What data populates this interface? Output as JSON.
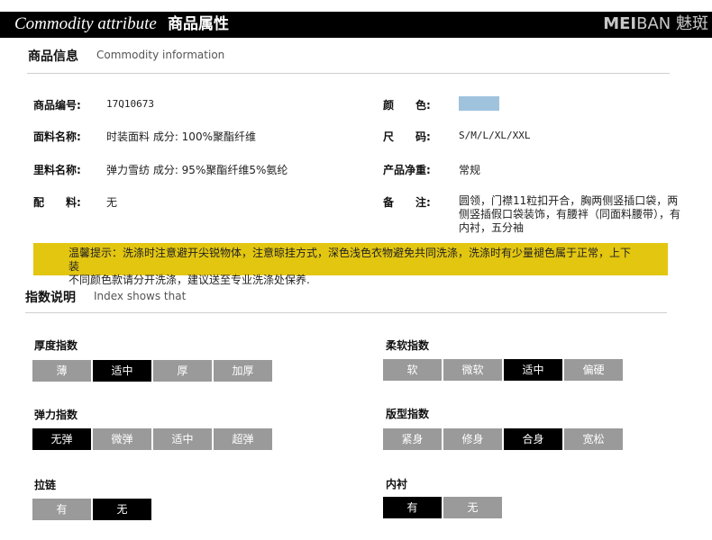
{
  "header": {
    "title_en": "Commodity attribute",
    "title_cn": "商品属性",
    "brand_bold": "MEI",
    "brand_light": "BAN",
    "brand_cn": "魅斑"
  },
  "info": {
    "title": "商品信息",
    "subtitle": "Commodity information",
    "left": [
      {
        "label": "商品编号:",
        "value": "17Q10673"
      },
      {
        "label": "面料名称:",
        "value": "时装面料 成分: 100%聚酯纤维"
      },
      {
        "label": "里料名称:",
        "value": "弹力雪纺 成分: 95%聚酯纤维5%氨纶"
      },
      {
        "label": "配　　料:",
        "value": "无"
      }
    ],
    "right": [
      {
        "label": "颜　　色:",
        "value": "",
        "swatch_color": "#9fc3dd"
      },
      {
        "label": "尺　　码:",
        "value": "S/M/L/XL/XXL"
      },
      {
        "label": "产品净重:",
        "value": "常规"
      },
      {
        "label": "备　　注:",
        "value": "圆领，门襟11粒扣开合，胸两侧竖插口袋，两侧竖插假口袋装饰，有腰袢（同面料腰带），有内衬，五分袖"
      }
    ],
    "notice_line1": "温馨提示：洗涤时注意避开尖锐物体，注意晾挂方式，深色浅色衣物避免共同洗涤，洗涤时有少量褪色属于正常，上下装",
    "notice_line2": "不同颜色款请分开洗涤，建议送至专业洗涤处保养."
  },
  "index": {
    "title": "指数说明",
    "subtitle": "Index shows that",
    "groups": [
      {
        "title": "厚度指数",
        "options": [
          "薄",
          "适中",
          "厚",
          "加厚"
        ],
        "selected": 1
      },
      {
        "title": "柔软指数",
        "options": [
          "软",
          "微软",
          "适中",
          "偏硬"
        ],
        "selected": 2
      },
      {
        "title": "弹力指数",
        "options": [
          "无弹",
          "微弹",
          "适中",
          "超弹"
        ],
        "selected": 0
      },
      {
        "title": "版型指数",
        "options": [
          "紧身",
          "修身",
          "合身",
          "宽松"
        ],
        "selected": 2
      },
      {
        "title": "拉链",
        "options": [
          "有",
          "无"
        ],
        "selected": 1
      },
      {
        "title": "内衬",
        "options": [
          "有",
          "无"
        ],
        "selected": 0
      }
    ]
  },
  "colors": {
    "topbar": "#000000",
    "notice_bg": "#e3c610",
    "option_default": "#9a9a9a",
    "option_selected": "#000000"
  }
}
